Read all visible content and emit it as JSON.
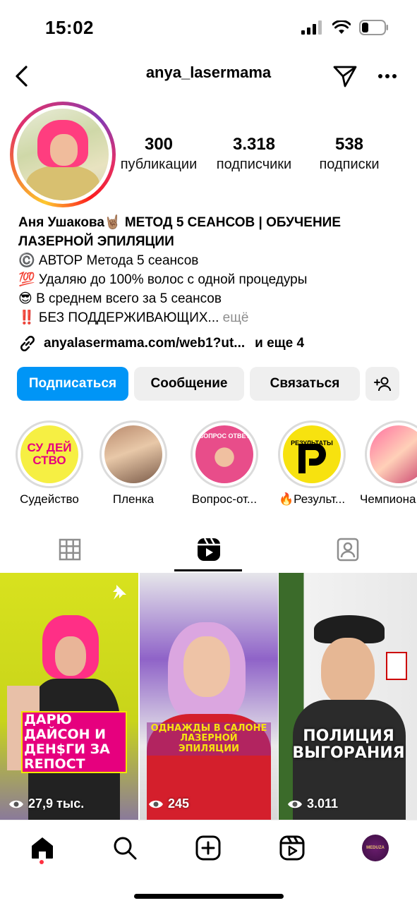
{
  "status_bar": {
    "time": "15:02"
  },
  "header": {
    "username": "anya_lasermama"
  },
  "stats": [
    {
      "value": "300",
      "label": "публикации"
    },
    {
      "value": "3.318",
      "label": "подписчики"
    },
    {
      "value": "538",
      "label": "подписки"
    }
  ],
  "bio": {
    "name": "Аня Ушакова🤘🏽 МЕТОД 5 СЕАНСОВ | ОБУЧЕНИЕ ЛАЗЕРНОЙ ЭПИЛЯЦИИ",
    "line1": "©️ АВТОР Метода 5 сеансов",
    "line2": "💯 Удаляю до 100% волос с одной процедуры",
    "line3": "😎 В среднем всего за 5 сеансов",
    "line4": "‼️ БЕЗ ПОДДЕРЖИВАЮЩИХ...",
    "more": "ещё",
    "link": "anyalasermama.com/web1?ut...",
    "link_more": "и еще 4"
  },
  "actions": {
    "follow": "Подписаться",
    "message": "Сообщение",
    "contact": "Связаться"
  },
  "highlights": [
    {
      "label": "Судейство",
      "cover_text": "СУ ДЕЙ СТВО"
    },
    {
      "label": "Пленка"
    },
    {
      "label": "Вопрос-от...",
      "cover_text": "ВОПРОС ОТВЕТ"
    },
    {
      "label": "🔥Результ...",
      "cover_text": "РЕЗУЛЬТАТЫ"
    },
    {
      "label": "Чемпиона"
    }
  ],
  "tabs": {
    "active": "reels"
  },
  "reels": [
    {
      "caption": "ДАРЮ ДАЙСОН И ДЕН$ГИ ЗА REПОСТ",
      "views": "27,9 тыс.",
      "pinned": true
    },
    {
      "caption": "ОДНАЖДЫ В САЛОНЕ ЛАЗЕРНОЙ ЭПИЛЯЦИИ",
      "views": "245"
    },
    {
      "caption": "ПОЛИЦИЯ ВЫГОРАНИЯ",
      "views": "3.011"
    }
  ],
  "colors": {
    "accent": "#0095f6",
    "notification": "#ff3040"
  },
  "bottom_nav": {
    "profile_avatar_text": "MEDUZA"
  }
}
